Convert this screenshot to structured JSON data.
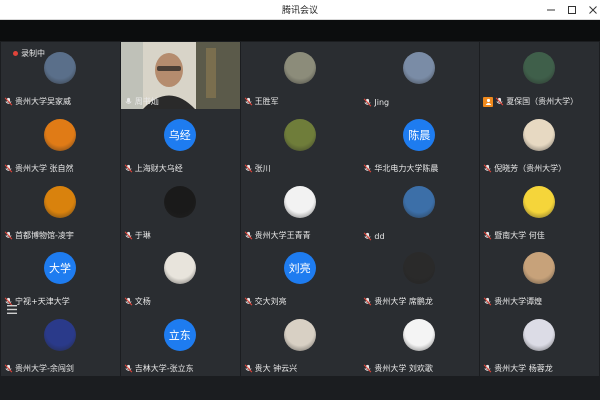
{
  "window": {
    "title": "腾讯会议"
  },
  "recording": {
    "label": "录制中"
  },
  "participants": [
    {
      "name": "贵州大学吴家威",
      "avatar": "photo",
      "color": "#5a6f8a"
    },
    {
      "name": "周书灿",
      "avatar": "video"
    },
    {
      "name": "王胜军",
      "avatar": "photo",
      "color": "#8c8c7a"
    },
    {
      "name": "Jing",
      "avatar": "photo",
      "color": "#7a8ca6"
    },
    {
      "name": "夏保国（贵州大学）",
      "avatar": "photo",
      "color": "#3f5f4a",
      "host": true
    },
    {
      "name": "贵州大学 张自然",
      "avatar": "photo",
      "color": "#e07b16"
    },
    {
      "name": "上海财大乌经",
      "avatar": "text",
      "initials": "乌经"
    },
    {
      "name": "张川",
      "avatar": "photo",
      "color": "#6f7d3a"
    },
    {
      "name": "华北电力大学陈晨",
      "avatar": "text",
      "initials": "陈晨"
    },
    {
      "name": "倪晓芳（贵州大学）",
      "avatar": "photo",
      "color": "#e7d9c2"
    },
    {
      "name": "首都博物馆-凌宇",
      "avatar": "photo",
      "color": "#d9820d"
    },
    {
      "name": "于琳",
      "avatar": "photo",
      "color": "#1a1a1a"
    },
    {
      "name": "贵州大学王青青",
      "avatar": "photo",
      "color": "#f2f2f2"
    },
    {
      "name": "dd",
      "avatar": "photo",
      "color": "#3c6fa8"
    },
    {
      "name": "暨南大学 何佳",
      "avatar": "photo",
      "color": "#f5d53a"
    },
    {
      "name": "宁视+天津大学",
      "avatar": "text",
      "initials": "大学"
    },
    {
      "name": "文杨",
      "avatar": "photo",
      "color": "#e8e4dc"
    },
    {
      "name": "交大刘亮",
      "avatar": "text",
      "initials": "刘亮"
    },
    {
      "name": "贵州大学 席鹏龙",
      "avatar": "photo",
      "color": "#2a2a2a"
    },
    {
      "name": "贵州大学谭煌",
      "avatar": "photo",
      "color": "#c7a27a"
    },
    {
      "name": "贵州大学-余闯剑",
      "avatar": "photo",
      "color": "#2a3a8a"
    },
    {
      "name": "吉林大学-张立东",
      "avatar": "text",
      "initials": "立东"
    },
    {
      "name": "贵大 钟云兴",
      "avatar": "photo",
      "color": "#d8d0c4"
    },
    {
      "name": "贵州大学 刘欢歌",
      "avatar": "photo",
      "color": "#f4f4f4"
    },
    {
      "name": "贵州大学 杨蓉龙",
      "avatar": "photo",
      "color": "#dcdce6"
    }
  ],
  "colors": {
    "accent": "#1e7cf0",
    "active_border": "#38b257",
    "tile_bg": "#2a2d31",
    "host_badge": "#f08a1d"
  }
}
